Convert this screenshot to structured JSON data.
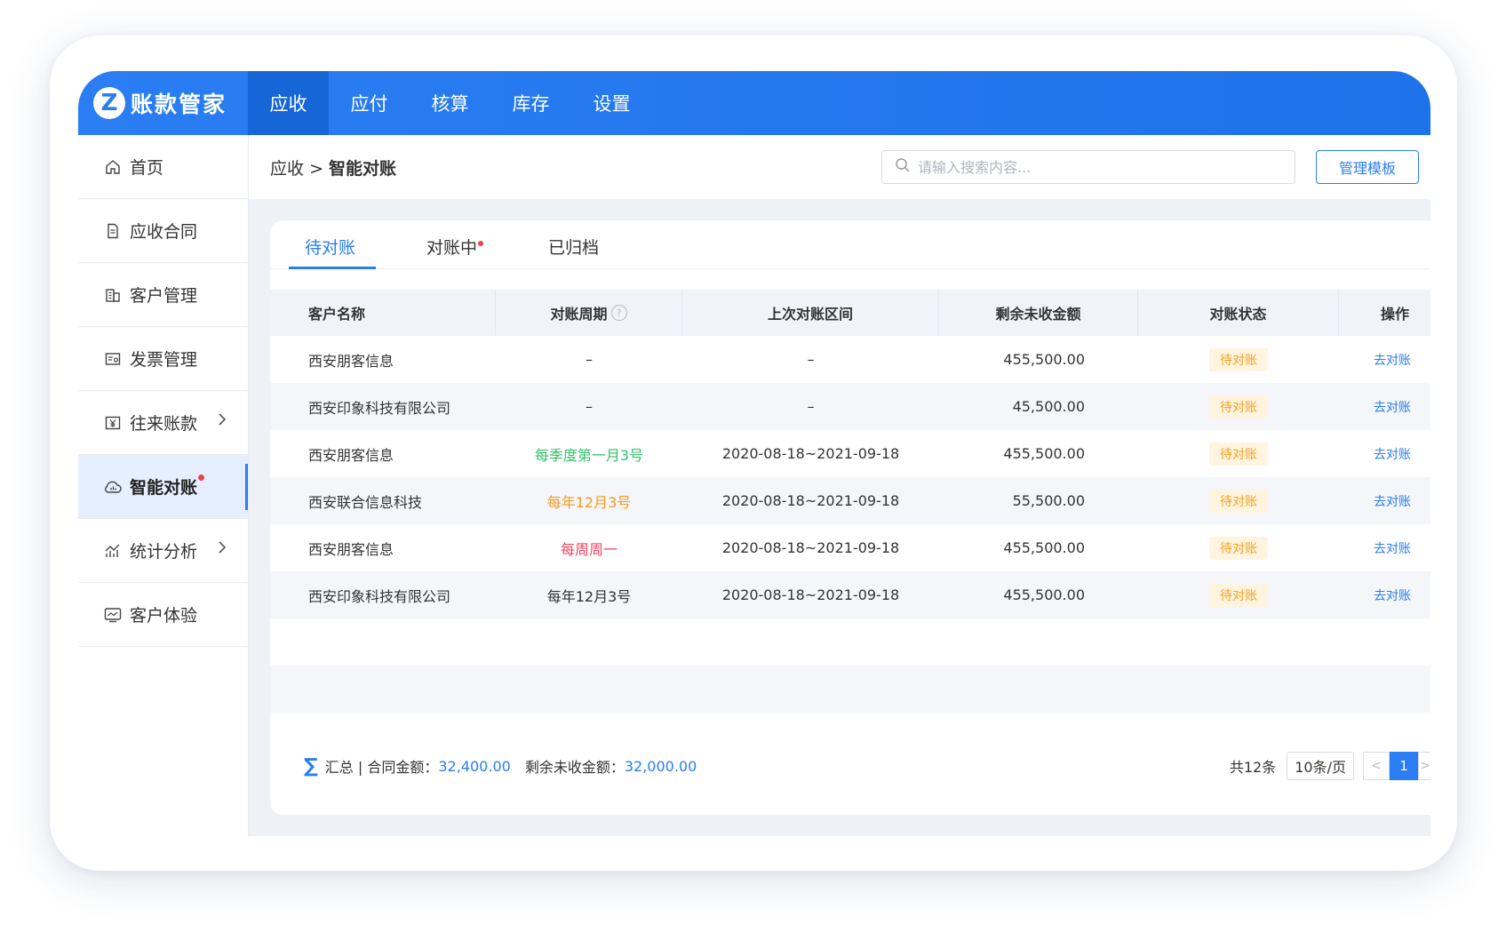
{
  "app": {
    "logo_letter": "Z",
    "name": "账款管家"
  },
  "topnav": [
    {
      "label": "应收",
      "active": true
    },
    {
      "label": "应付"
    },
    {
      "label": "核算"
    },
    {
      "label": "库存"
    },
    {
      "label": "设置"
    }
  ],
  "sidebar": {
    "items": [
      {
        "label": "首页",
        "icon": "home-icon"
      },
      {
        "label": "应收合同",
        "icon": "document-icon"
      },
      {
        "label": "客户管理",
        "icon": "building-icon"
      },
      {
        "label": "发票管理",
        "icon": "invoice-icon"
      },
      {
        "label": "往来账款",
        "icon": "yen-icon",
        "chevron": true
      },
      {
        "label": "智能对账",
        "icon": "cloud-chart-icon",
        "active": true,
        "dot": true
      },
      {
        "label": "统计分析",
        "icon": "trend-chart-icon",
        "chevron": true
      },
      {
        "label": "客户体验",
        "icon": "monitor-icon"
      }
    ]
  },
  "header": {
    "breadcrumb_parent": "应收",
    "breadcrumb_sep": ">",
    "breadcrumb_current": "智能对账",
    "search_placeholder": "请输入搜索内容...",
    "manage_template_label": "管理模板"
  },
  "tabs": [
    {
      "label": "待对账",
      "active": true
    },
    {
      "label": "对账中",
      "dot": true
    },
    {
      "label": "已归档"
    }
  ],
  "table": {
    "columns": [
      "客户名称",
      "对账周期",
      "上次对账区间",
      "剩余未收金额",
      "对账状态",
      "操作"
    ],
    "help_icon": "question-circle-icon",
    "rows": [
      {
        "customer": "西安朋客信息",
        "cycle": "–",
        "cycle_color": "default",
        "range": "–",
        "amount": "455,500.00",
        "status": "待对账",
        "action": "去对账"
      },
      {
        "customer": "西安印象科技有限公司",
        "cycle": "–",
        "cycle_color": "default",
        "range": "–",
        "amount": "45,500.00",
        "status": "待对账",
        "action": "去对账"
      },
      {
        "customer": "西安朋客信息",
        "cycle": "每季度第一月3号",
        "cycle_color": "green",
        "range": "2020-08-18~2021-09-18",
        "amount": "455,500.00",
        "status": "待对账",
        "action": "去对账"
      },
      {
        "customer": "西安联合信息科技",
        "cycle": "每年12月3号",
        "cycle_color": "orange",
        "range": "2020-08-18~2021-09-18",
        "amount": "55,500.00",
        "status": "待对账",
        "action": "去对账"
      },
      {
        "customer": "西安朋客信息",
        "cycle": "每周周一",
        "cycle_color": "red",
        "range": "2020-08-18~2021-09-18",
        "amount": "455,500.00",
        "status": "待对账",
        "action": "去对账"
      },
      {
        "customer": "西安印象科技有限公司",
        "cycle": "每年12月3号",
        "cycle_color": "default",
        "range": "2020-08-18~2021-09-18",
        "amount": "455,500.00",
        "status": "待对账",
        "action": "去对账"
      }
    ]
  },
  "footer": {
    "sum_symbol": "∑",
    "summary_label": "汇总 | 合同金额：",
    "contract_amount": "32,400.00",
    "remaining_label": "剩余未收金额：",
    "remaining_amount": "32,000.00",
    "total": "共12条",
    "page_size": "10条/页",
    "prev": "<",
    "current_page": "1",
    "next": ">"
  },
  "colors": {
    "primary": "#2a7df2",
    "green": "#34c26a",
    "orange": "#f59a23",
    "red": "#f5455c",
    "badge_bg": "#fff4e0"
  }
}
